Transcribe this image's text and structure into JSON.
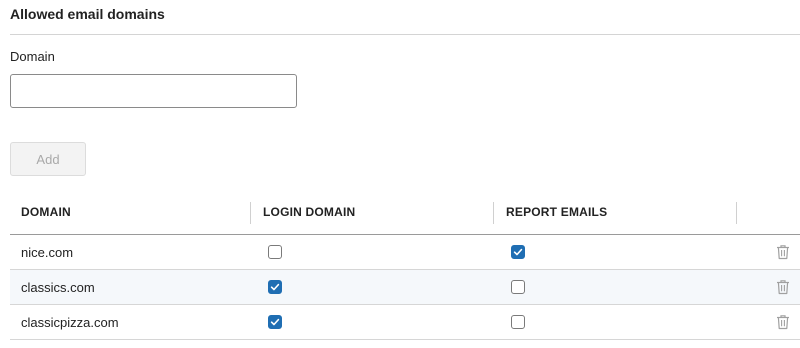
{
  "section": {
    "title": "Allowed email domains"
  },
  "form": {
    "domain_label": "Domain",
    "domain_value": "",
    "add_label": "Add"
  },
  "table": {
    "columns": [
      "DOMAIN",
      "LOGIN DOMAIN",
      "REPORT EMAILS"
    ],
    "rows": [
      {
        "domain": "nice.com",
        "login_domain": false,
        "report_emails": true
      },
      {
        "domain": "classics.com",
        "login_domain": true,
        "report_emails": false
      },
      {
        "domain": "classicpizza.com",
        "login_domain": true,
        "report_emails": false
      }
    ]
  },
  "icons": {
    "checkbox_checked": "check-icon",
    "delete": "trash-icon"
  },
  "colors": {
    "checkbox_checked": "#1f6eb3",
    "alt_row": "#f5f8fb",
    "icon_gray": "#a0a0a0"
  }
}
